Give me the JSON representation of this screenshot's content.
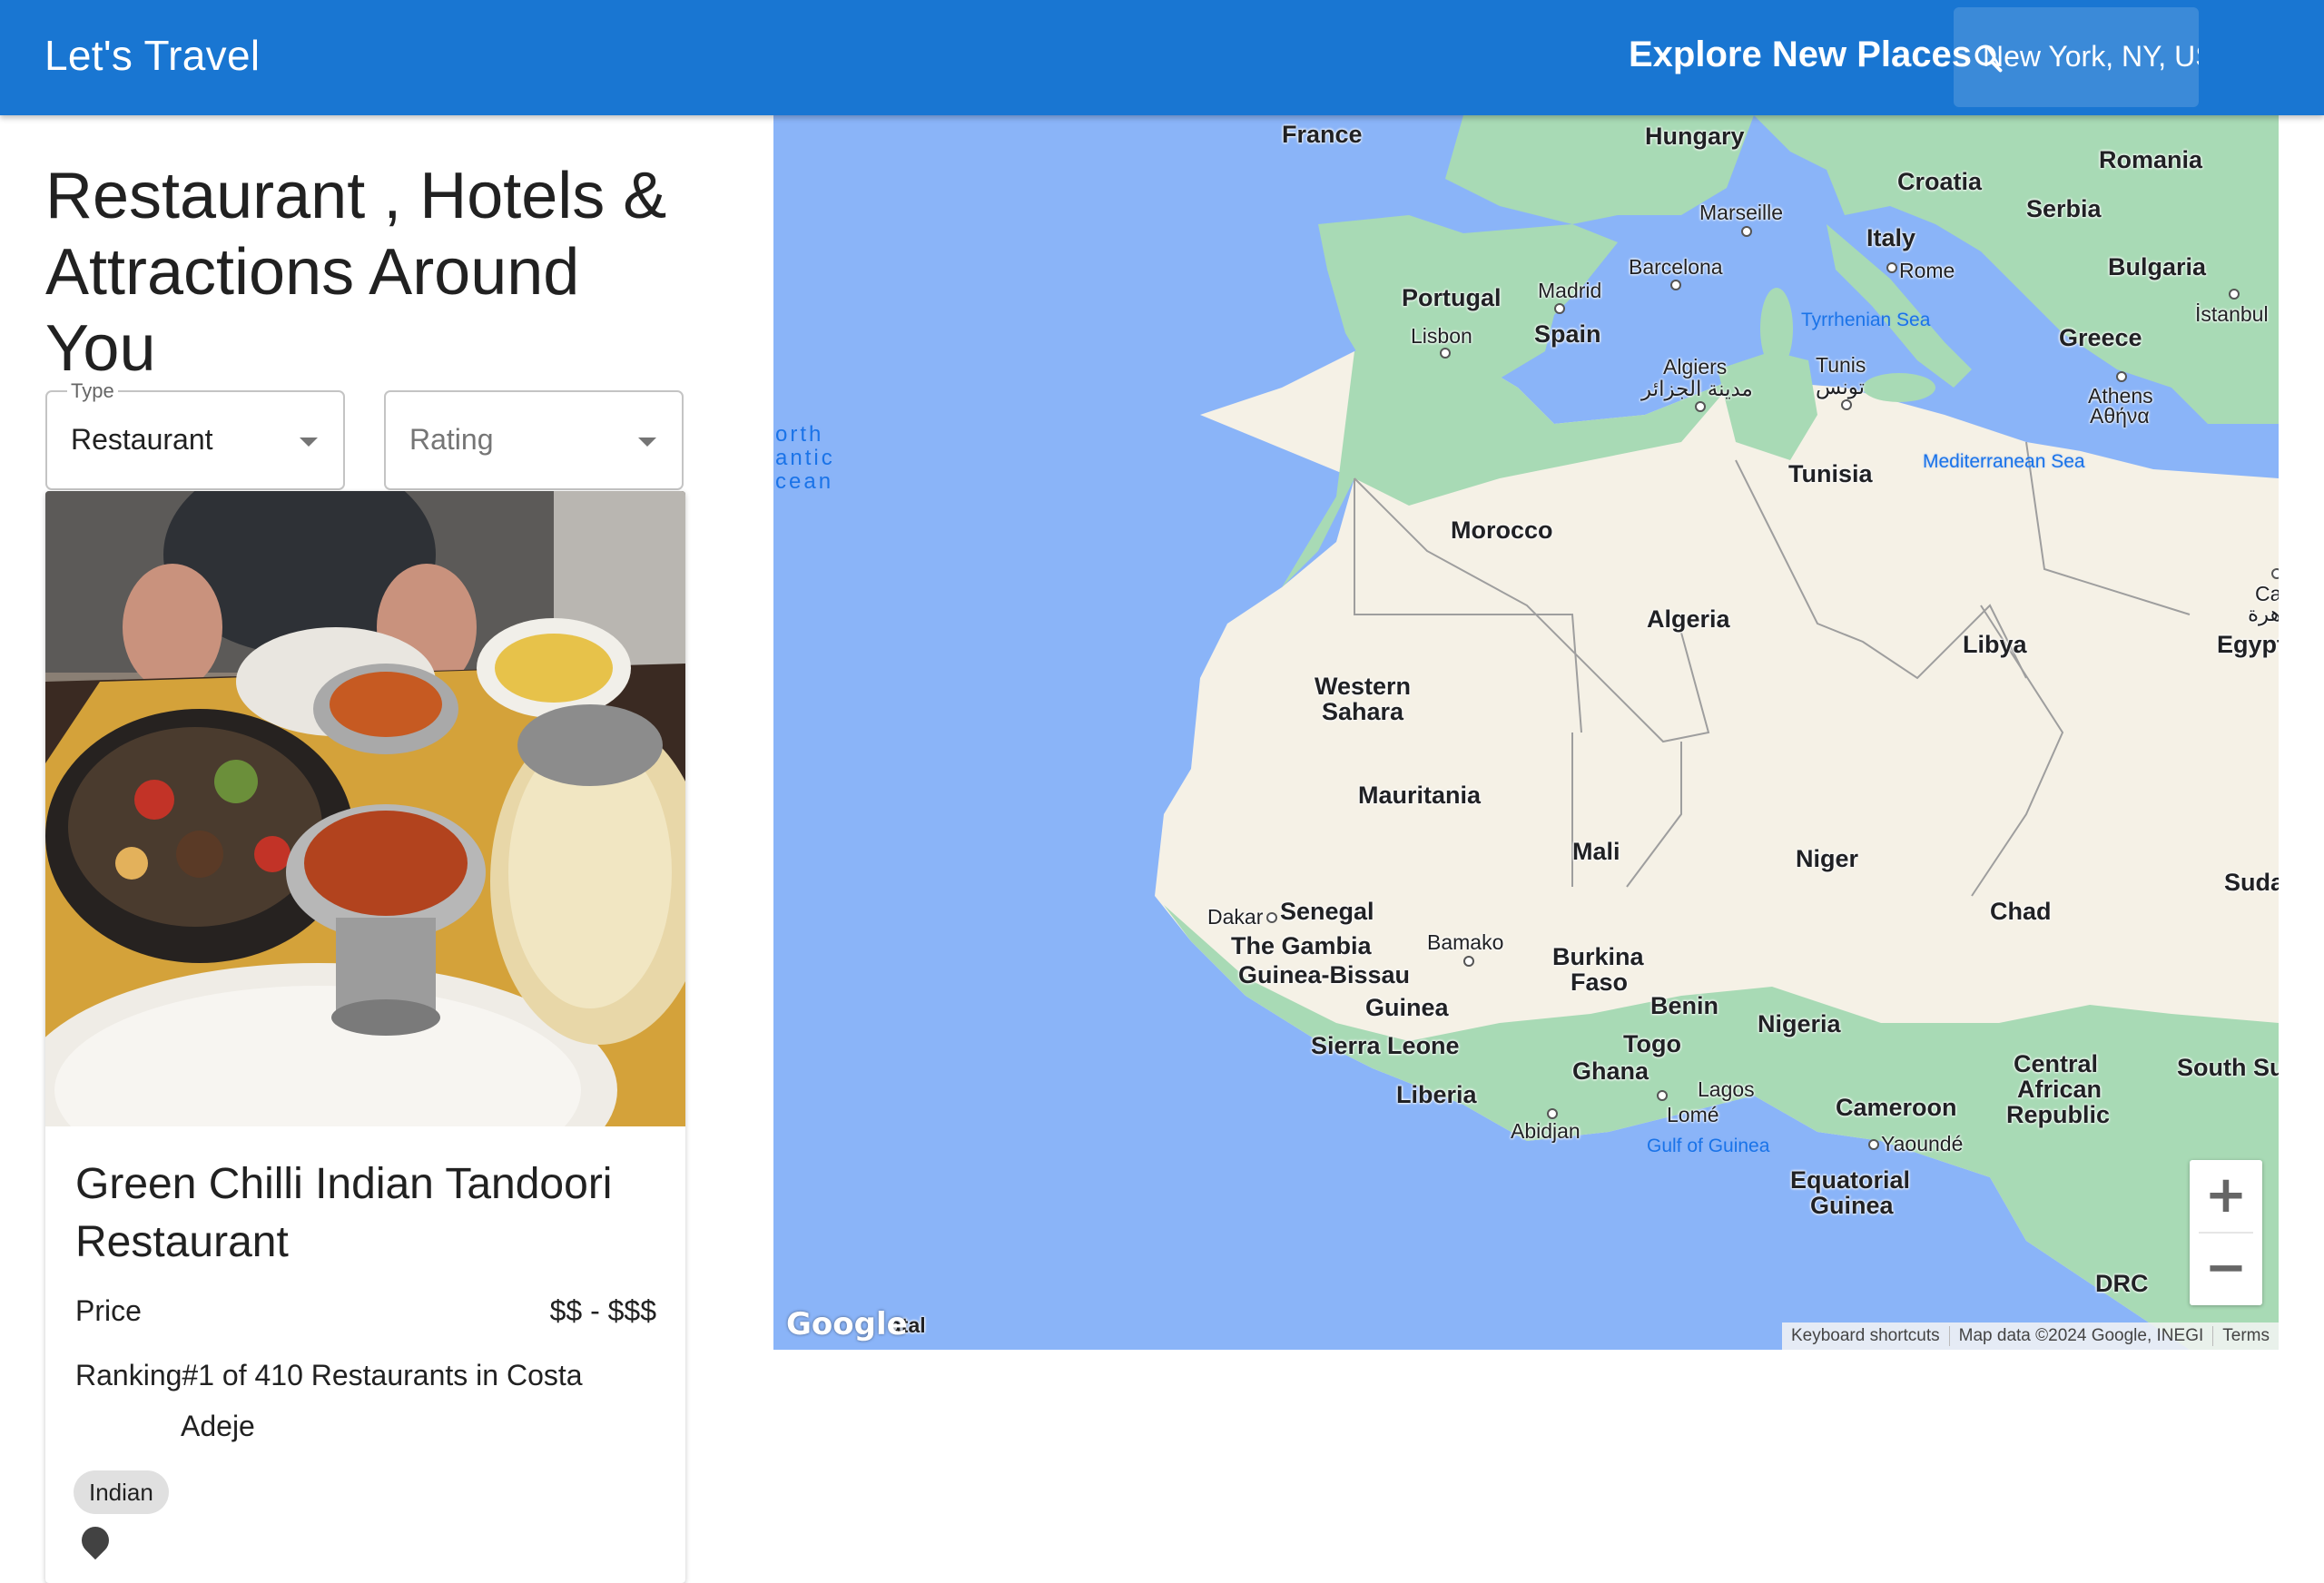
{
  "app": {
    "title": "Let's Travel",
    "explore_label": "Explore New Places",
    "search": {
      "value": "New York, NY, USA",
      "icon": "search-icon"
    }
  },
  "page": {
    "title": "Restaurant , Hotels & Attractions Around You"
  },
  "filters": {
    "type": {
      "label": "Type",
      "value": "Restaurant"
    },
    "rating": {
      "placeholder": "Rating",
      "value": ""
    }
  },
  "place_card": {
    "name": "Green Chilli Indian Tandoori Restaurant",
    "price_label": "Price",
    "price_value": "$$ - $$$",
    "ranking": "Ranking#1 of 410 Restaurants in Costa",
    "ranking_city": "Adeje",
    "cuisine_tag": "Indian"
  },
  "map": {
    "labels": {
      "france": "France",
      "hungary": "Hungary",
      "romania": "Romania",
      "croatia": "Croatia",
      "serbia": "Serbia",
      "marseille": "Marseille",
      "italy": "Italy",
      "rome": "Rome",
      "bulgaria": "Bulgaria",
      "istanbul": "İstanbul",
      "barcelona": "Barcelona",
      "portugal": "Portugal",
      "madrid": "Madrid",
      "spain": "Spain",
      "lisbon": "Lisbon",
      "tyrrhenian_sea": "Tyrrhenian Sea",
      "greece": "Greece",
      "algiers": "Algiers",
      "algiers_ar": "مدينة الجزائر",
      "tunis": "Tunis",
      "tunis_ar": "تونس",
      "athens": "Athens",
      "athens_gr": "Αθήνα",
      "north_atlantic_1": "orth",
      "north_atlantic_2": "antic",
      "north_atlantic_3": "cean",
      "tunisia": "Tunisia",
      "mediterranean": "Mediterranean Sea",
      "morocco": "Morocco",
      "algeria": "Algeria",
      "libya": "Libya",
      "egypt": "Egypt",
      "cairo_1": "Ca",
      "cairo_2": "هرة",
      "western_sahara_1": "Western",
      "western_sahara_2": "Sahara",
      "mauritania": "Mauritania",
      "mali": "Mali",
      "niger": "Niger",
      "sudan": "Suda",
      "chad": "Chad",
      "dakar": "Dakar",
      "senegal": "Senegal",
      "gambia": "The Gambia",
      "bamako": "Bamako",
      "burkina_1": "Burkina",
      "burkina_2": "Faso",
      "guinea_bissau": "Guinea-Bissau",
      "benin": "Benin",
      "guinea": "Guinea",
      "nigeria": "Nigeria",
      "sierra_leone": "Sierra Leone",
      "togo": "Togo",
      "car_1": "Central",
      "car_2": "African",
      "car_3": "Republic",
      "south_sudan": "South Su",
      "ghana": "Ghana",
      "lagos": "Lagos",
      "liberia": "Liberia",
      "lome": "Lomé",
      "cameroon": "Cameroon",
      "abidjan": "Abidjan",
      "gulf_guinea": "Gulf of Guinea",
      "yaounde": "Yaoundé",
      "eq_guinea_1": "Equatorial",
      "eq_guinea_2": "Guinea",
      "drc": "DRC",
      "natal": "atal"
    },
    "zoom_in": "+",
    "zoom_out": "−",
    "logo": "Google",
    "attribution": {
      "shortcuts": "Keyboard shortcuts",
      "map_data": "Map data ©2024 Google, INEGI",
      "terms": "Terms"
    },
    "colors": {
      "water": "#8ab4f8",
      "land_green": "#a8dab5",
      "land_desert": "#f5f1e6"
    }
  }
}
